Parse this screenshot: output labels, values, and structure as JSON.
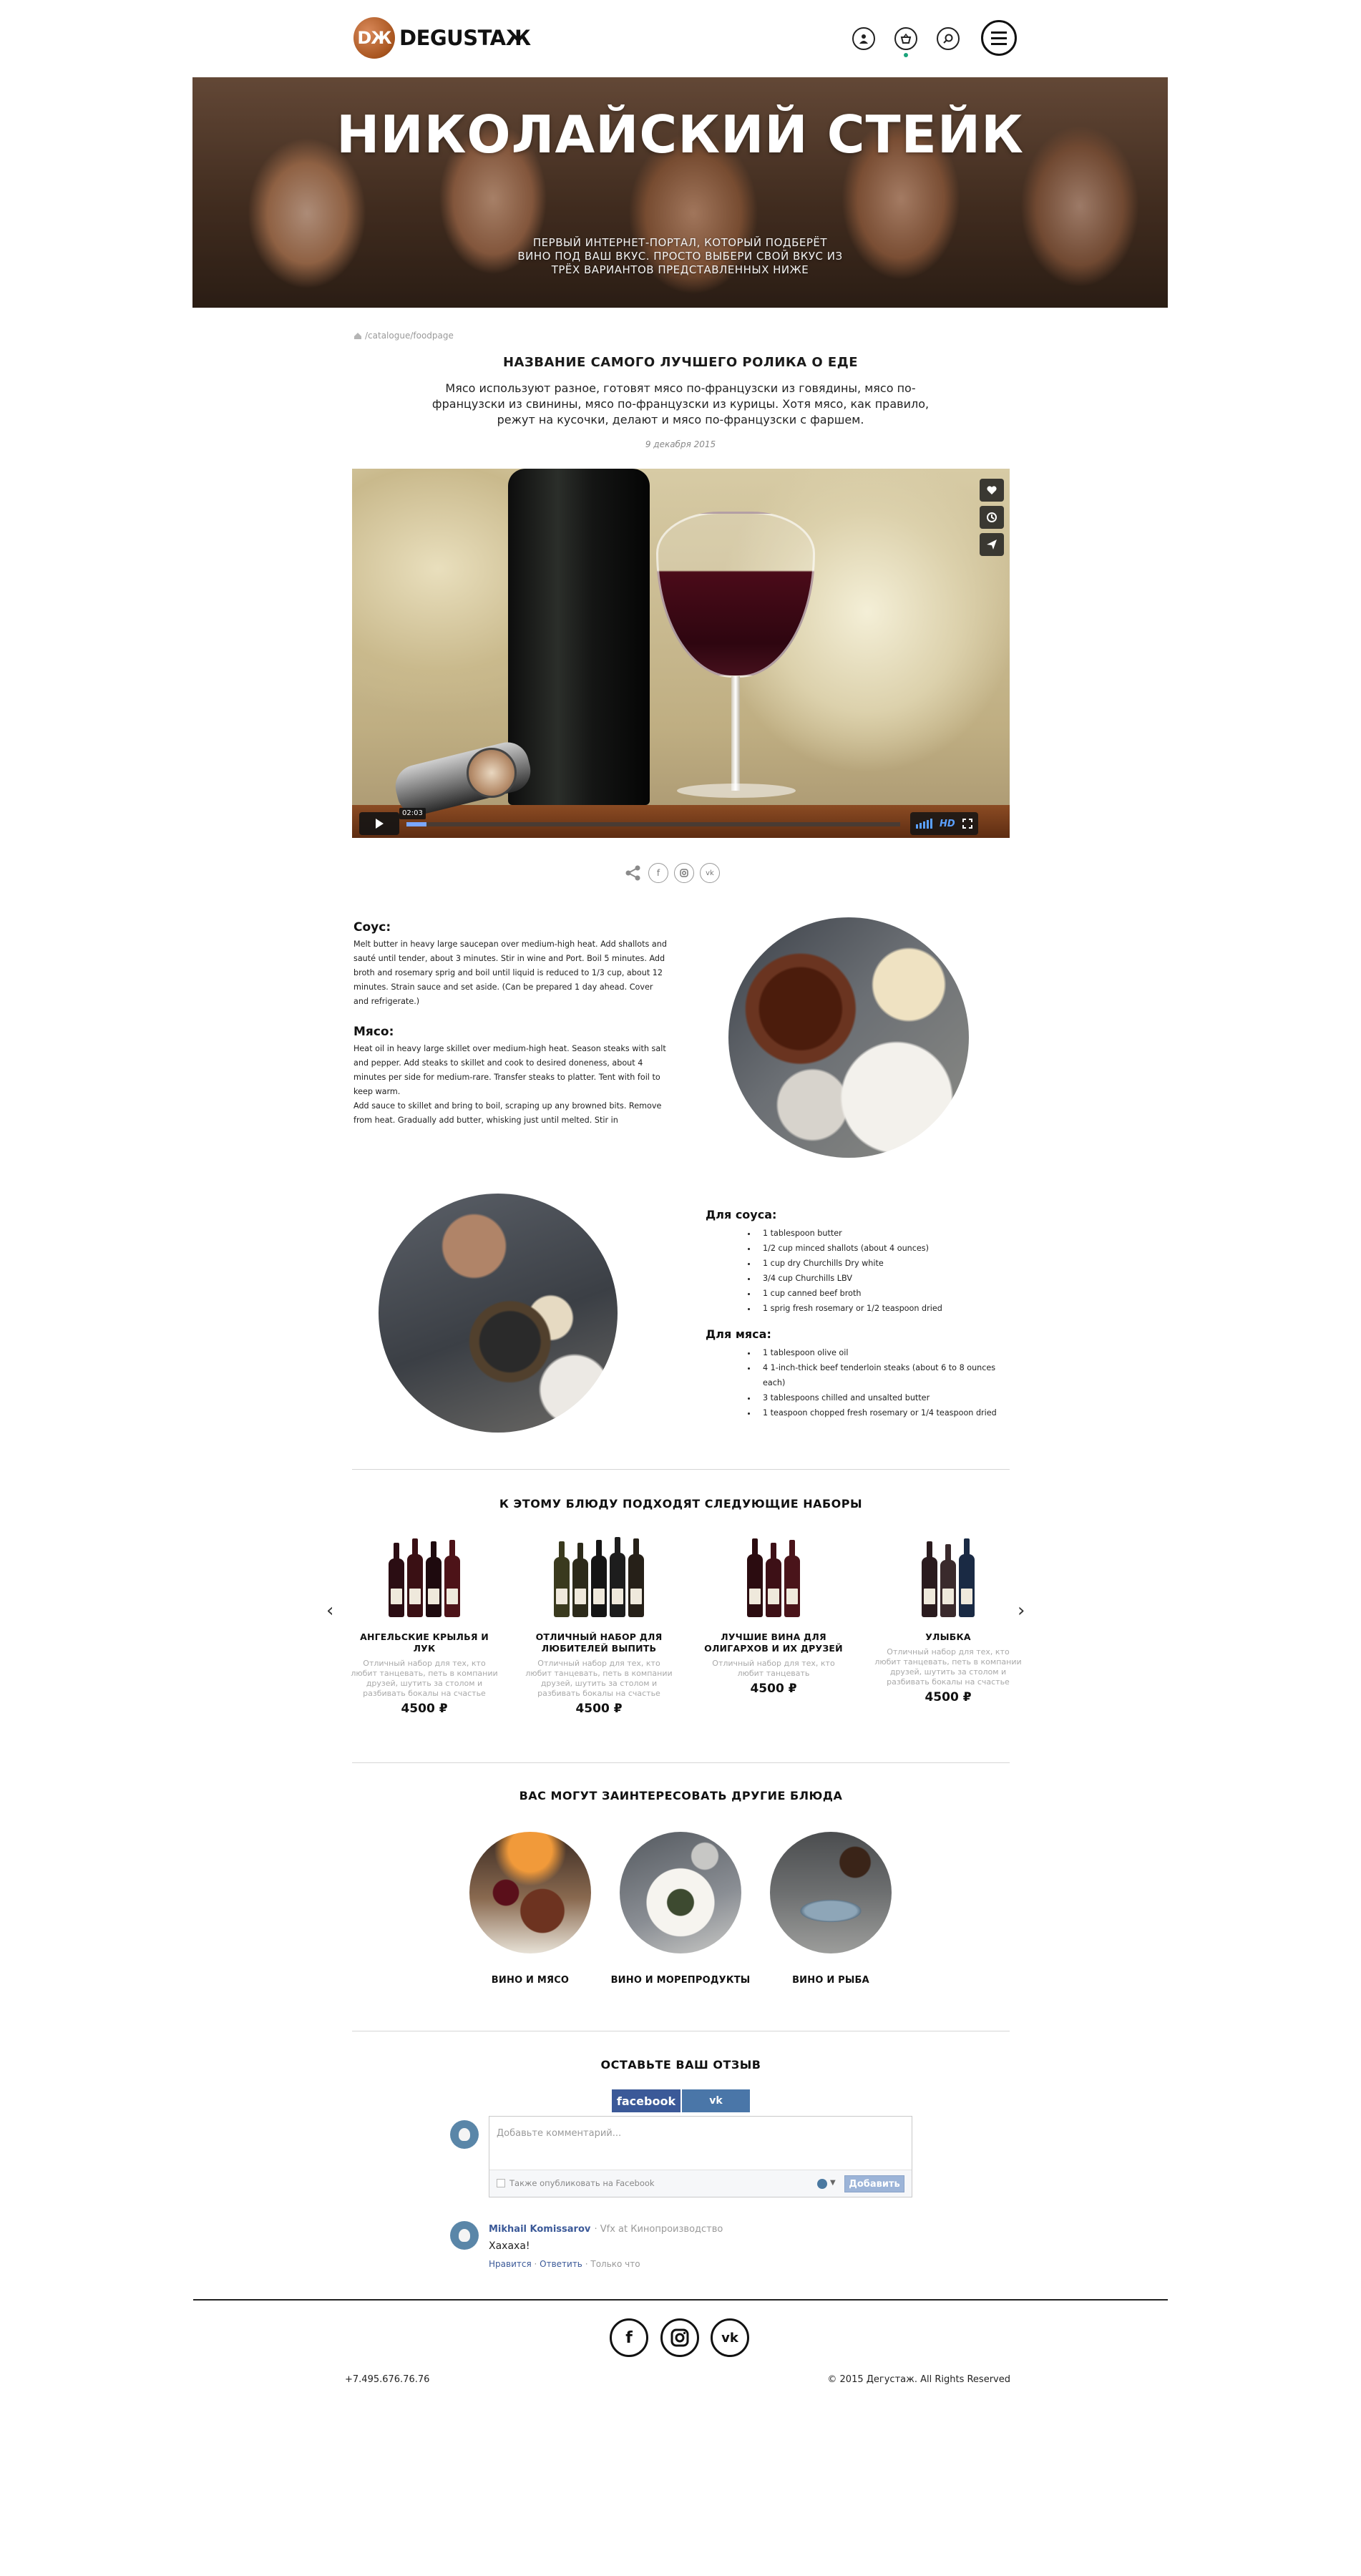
{
  "brand": {
    "logo_badge": "DЖ",
    "logo_text": "DEGUSTAЖ"
  },
  "header": {
    "icons": [
      "user-icon",
      "basket-icon",
      "search-icon",
      "menu-icon"
    ]
  },
  "hero": {
    "title": "НИКОЛАЙСКИЙ СТЕЙК",
    "subtitle": "ПЕРВЫЙ ИНТЕРНЕТ-ПОРТАЛ, КОТОРЫЙ ПОДБЕРЁТ ВИНО ПОД ВАШ ВКУС. ПРОСТО ВЫБЕРИ СВОЙ ВКУС ИЗ ТРЁХ ВАРИАНТОВ ПРЕДСТАВЛЕННЫХ НИЖЕ"
  },
  "breadcrumb": {
    "path": "/catalogue/foodpage"
  },
  "article": {
    "title": "НАЗВАНИЕ САМОГО ЛУЧШЕГО РОЛИКА О ЕДЕ",
    "lead": "Мясо используют разное, готовят мясо по-французски из говядины, мясо по-французски из свинины, мясо по-французски из курицы. Хотя мясо, как правило, режут на кусочки, делают и мясо по-французски с фаршем.",
    "date": "9 декабря 2015"
  },
  "video": {
    "time": "02:03",
    "hd_label": "HD",
    "progress": 0.04
  },
  "recipe": {
    "sauce_heading": "Соус:",
    "sauce_text": "Melt butter in heavy large saucepan over medium-high heat. Add shallots and sauté until tender, about 3 minutes. Stir in wine and Port. Boil 5 minutes. Add broth and rosemary sprig and boil until liquid is reduced to 1/3 cup, about 12 minutes. Strain sauce and set aside. (Can be prepared 1 day ahead. Cover and refrigerate.)",
    "meat_heading": "Мясо:",
    "meat_text": "Heat oil in heavy large skillet over medium-high heat. Season steaks with salt and pepper. Add steaks to skillet and cook to desired doneness, about 4 minutes per side for medium-rare. Transfer steaks to platter. Tent with foil to keep warm.",
    "meat_text_2": "Add sauce to skillet and bring to boil, scraping up any browned bits. Remove from heat. Gradually add butter, whisking just until melted. Stir in"
  },
  "ingredients": {
    "sauce_heading": "Для соуса:",
    "sauce_items": [
      "1 tablespoon butter",
      "1/2 cup minced shallots (about 4 ounces)",
      "1 cup dry Churchills Dry white",
      "3/4 cup Churchills LBV",
      "1 cup canned beef broth",
      "1 sprig fresh rosemary or 1/2 teaspoon dried"
    ],
    "meat_heading": "Для мяса:",
    "meat_items": [
      "1 tablespoon olive oil",
      "4 1-inch-thick beef tenderloin steaks (about 6 to 8 ounces each)",
      "3 tablespoons chilled and unsalted butter",
      "1 teaspoon chopped fresh rosemary or 1/4 teaspoon dried"
    ]
  },
  "sets": {
    "title": "К ЭТОМУ БЛЮДУ ПОДХОДЯТ СЛЕДУЮЩИЕ НАБОРЫ",
    "items": [
      {
        "name": "АНГЕЛЬСКИЕ КРЫЛЬЯ И ЛУК",
        "desc": "Отличный набор для тех, кто любит танцевать, петь в компании друзей, шутить за столом и разбивать бокалы на счастье",
        "price": "4500 ₽"
      },
      {
        "name": "ОТЛИЧНЫЙ НАБОР ДЛЯ ЛЮБИТЕЛЕЙ ВЫПИТЬ",
        "desc": "Отличный набор для тех, кто любит танцевать, петь в компании друзей, шутить за столом и разбивать бокалы на счастье",
        "price": "4500 ₽"
      },
      {
        "name": "ЛУЧШИЕ ВИНА ДЛЯ ОЛИГАРХОВ И ИХ ДРУЗЕЙ",
        "desc": "Отличный набор для тех, кто любит танцевать",
        "price": "4500 ₽"
      },
      {
        "name": "УЛЫБКА",
        "desc": "Отличный набор для тех, кто любит танцевать, петь в компании друзей, шутить за столом и разбивать бокалы на счастье",
        "price": "4500 ₽"
      }
    ]
  },
  "dishes": {
    "title": "ВАС МОГУТ ЗАИНТЕРЕСОВАТЬ ДРУГИЕ БЛЮДА",
    "items": [
      {
        "label": "ВИНО И МЯСО"
      },
      {
        "label": "ВИНО И МОРЕПРОДУКТЫ"
      },
      {
        "label": "ВИНО И РЫБА"
      }
    ]
  },
  "comments": {
    "title": "ОСТАВЬТЕ ВАШ ОТЗЫВ",
    "tab_fb": "facebook",
    "tab_vk": "vk",
    "placeholder": "Добавьте комментарий...",
    "also_post": "Также опубликовать на Facebook",
    "submit": "Добавить",
    "entry": {
      "author": "Mikhail Komissarov",
      "meta": "· Vfx at Кинопроизводство",
      "text": "Хахаха!",
      "like": "Нравится",
      "reply": "Ответить",
      "time": "Только что"
    }
  },
  "footer": {
    "phone": "+7.495.676.76.76",
    "copyright": "© 2015 Дегустаж. All Rights Reserved",
    "social": [
      "f",
      "ig",
      "vk"
    ]
  },
  "colors": {
    "accent_brown": "#a8551f",
    "fb_blue": "#3b5998",
    "vk_blue": "#4a76a8"
  }
}
